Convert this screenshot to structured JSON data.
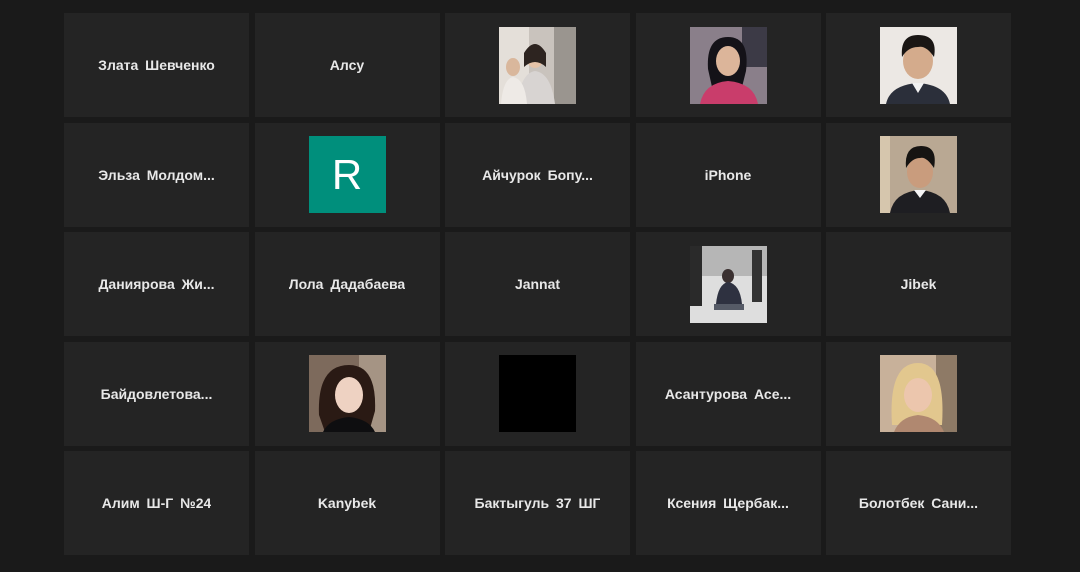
{
  "participants": [
    {
      "name": "Злата Шевченко"
    },
    {
      "name": "Алсу"
    },
    {
      "photo": "participant-photo"
    },
    {
      "photo": "participant-photo"
    },
    {
      "photo": "participant-photo"
    },
    {
      "name": "Эльза Молдом..."
    },
    {
      "avatar_letter": "R",
      "avatar_color": "#008f7c"
    },
    {
      "name": "Айчурок Бопу..."
    },
    {
      "name": "iPhone"
    },
    {
      "photo": "participant-photo"
    },
    {
      "name": "Даниярова Жи..."
    },
    {
      "name": "Лола Дадабаева"
    },
    {
      "name": "Jannat"
    },
    {
      "photo": "participant-video-frame"
    },
    {
      "name": "Jibek"
    },
    {
      "name": "Байдовлетова..."
    },
    {
      "photo": "participant-photo"
    },
    {
      "video": "black-video-frame"
    },
    {
      "name": "Асантурова Асе..."
    },
    {
      "photo": "participant-photo"
    },
    {
      "name": "Алим Ш-Г №24"
    },
    {
      "name": "Kanybek"
    },
    {
      "name": "Бактыгуль 37 ШГ"
    },
    {
      "name": "Ксения Щербак..."
    },
    {
      "name": "Болотбек Сани..."
    }
  ]
}
